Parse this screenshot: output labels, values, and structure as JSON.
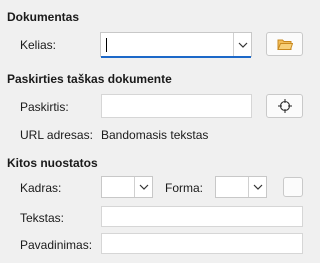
{
  "document": {
    "title": "Dokumentas",
    "path_label": "Kelias:",
    "path_value": ""
  },
  "target": {
    "title": "Paskirties taškas dokumente",
    "target_label": "Paskirtis:",
    "target_value": "",
    "url_label": "URL adresas:",
    "url_value": "Bandomasis tekstas"
  },
  "other": {
    "title": "Kitos nuostatos",
    "frame_label": "Kadras:",
    "frame_value": "",
    "form_label": "Forma:",
    "form_value": "",
    "text_label": "Tekstas:",
    "text_value": "",
    "name_label": "Pavadinimas:",
    "name_value": ""
  },
  "icons": {
    "browse": "folder-icon",
    "target": "crosshair-icon",
    "dropdown": "chevron-down-icon"
  },
  "colors": {
    "folder": "#e8a33a",
    "focus_underline": "#1c68c8"
  }
}
